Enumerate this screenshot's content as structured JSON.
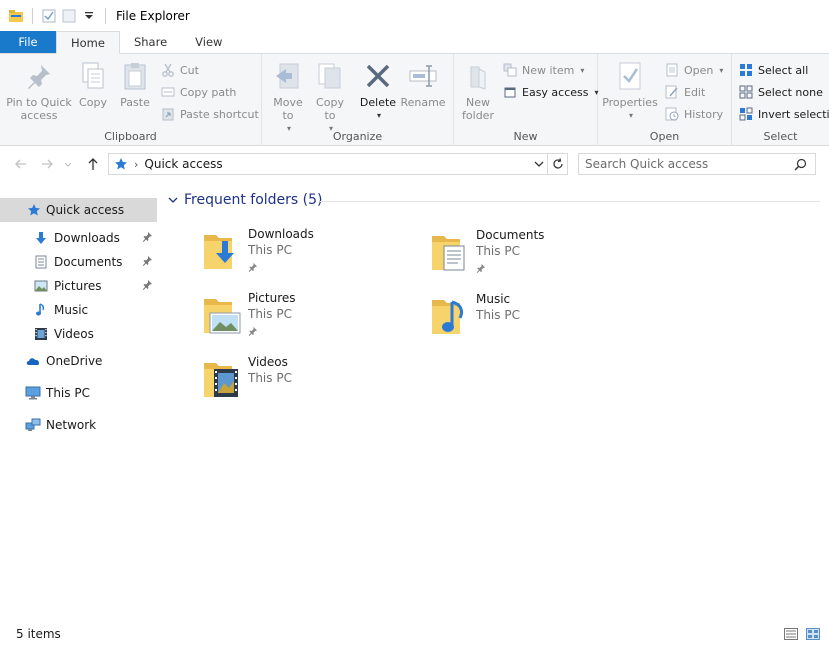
{
  "window": {
    "title": "File Explorer"
  },
  "tabs": [
    {
      "label": "File"
    },
    {
      "label": "Home"
    },
    {
      "label": "Share"
    },
    {
      "label": "View"
    }
  ],
  "ribbon": {
    "clipboard": {
      "label": "Clipboard",
      "pin_label": "Pin to Quick access",
      "copy_label": "Copy",
      "paste_label": "Paste",
      "cut_label": "Cut",
      "copy_path_label": "Copy path",
      "paste_shortcut_label": "Paste shortcut"
    },
    "organize": {
      "label": "Organize",
      "move_to_label": "Move to",
      "copy_to_label": "Copy to",
      "delete_label": "Delete",
      "rename_label": "Rename"
    },
    "new": {
      "label": "New",
      "new_folder_label": "New folder",
      "new_item_label": "New item",
      "easy_access_label": "Easy access"
    },
    "open": {
      "label": "Open",
      "properties_label": "Properties",
      "open_label": "Open",
      "edit_label": "Edit",
      "history_label": "History"
    },
    "select": {
      "label": "Select",
      "select_all_label": "Select all",
      "select_none_label": "Select none",
      "invert_label": "Invert selection"
    }
  },
  "address": {
    "location": "Quick access"
  },
  "search": {
    "placeholder": "Search Quick access"
  },
  "nav_pane": {
    "quick_access": "Quick access",
    "pinned": [
      {
        "label": "Downloads",
        "pinned": true
      },
      {
        "label": "Documents",
        "pinned": true
      },
      {
        "label": "Pictures",
        "pinned": true
      },
      {
        "label": "Music",
        "pinned": false
      },
      {
        "label": "Videos",
        "pinned": false
      }
    ],
    "onedrive": "OneDrive",
    "this_pc": "This PC",
    "network": "Network"
  },
  "content": {
    "group_title": "Frequent folders (5)",
    "folders": [
      {
        "name": "Downloads",
        "location": "This PC",
        "pinned": true
      },
      {
        "name": "Documents",
        "location": "This PC",
        "pinned": true
      },
      {
        "name": "Pictures",
        "location": "This PC",
        "pinned": true
      },
      {
        "name": "Music",
        "location": "This PC",
        "pinned": false
      },
      {
        "name": "Videos",
        "location": "This PC",
        "pinned": false
      }
    ]
  },
  "status": {
    "item_count": "5 items"
  },
  "colors": {
    "file_tab": "#1979ca",
    "accent_blue": "#2b7bd6",
    "header_blue": "#1e3287",
    "folder_yellow": "#f7d36b",
    "ribbon_bg": "#f5f6f7"
  }
}
